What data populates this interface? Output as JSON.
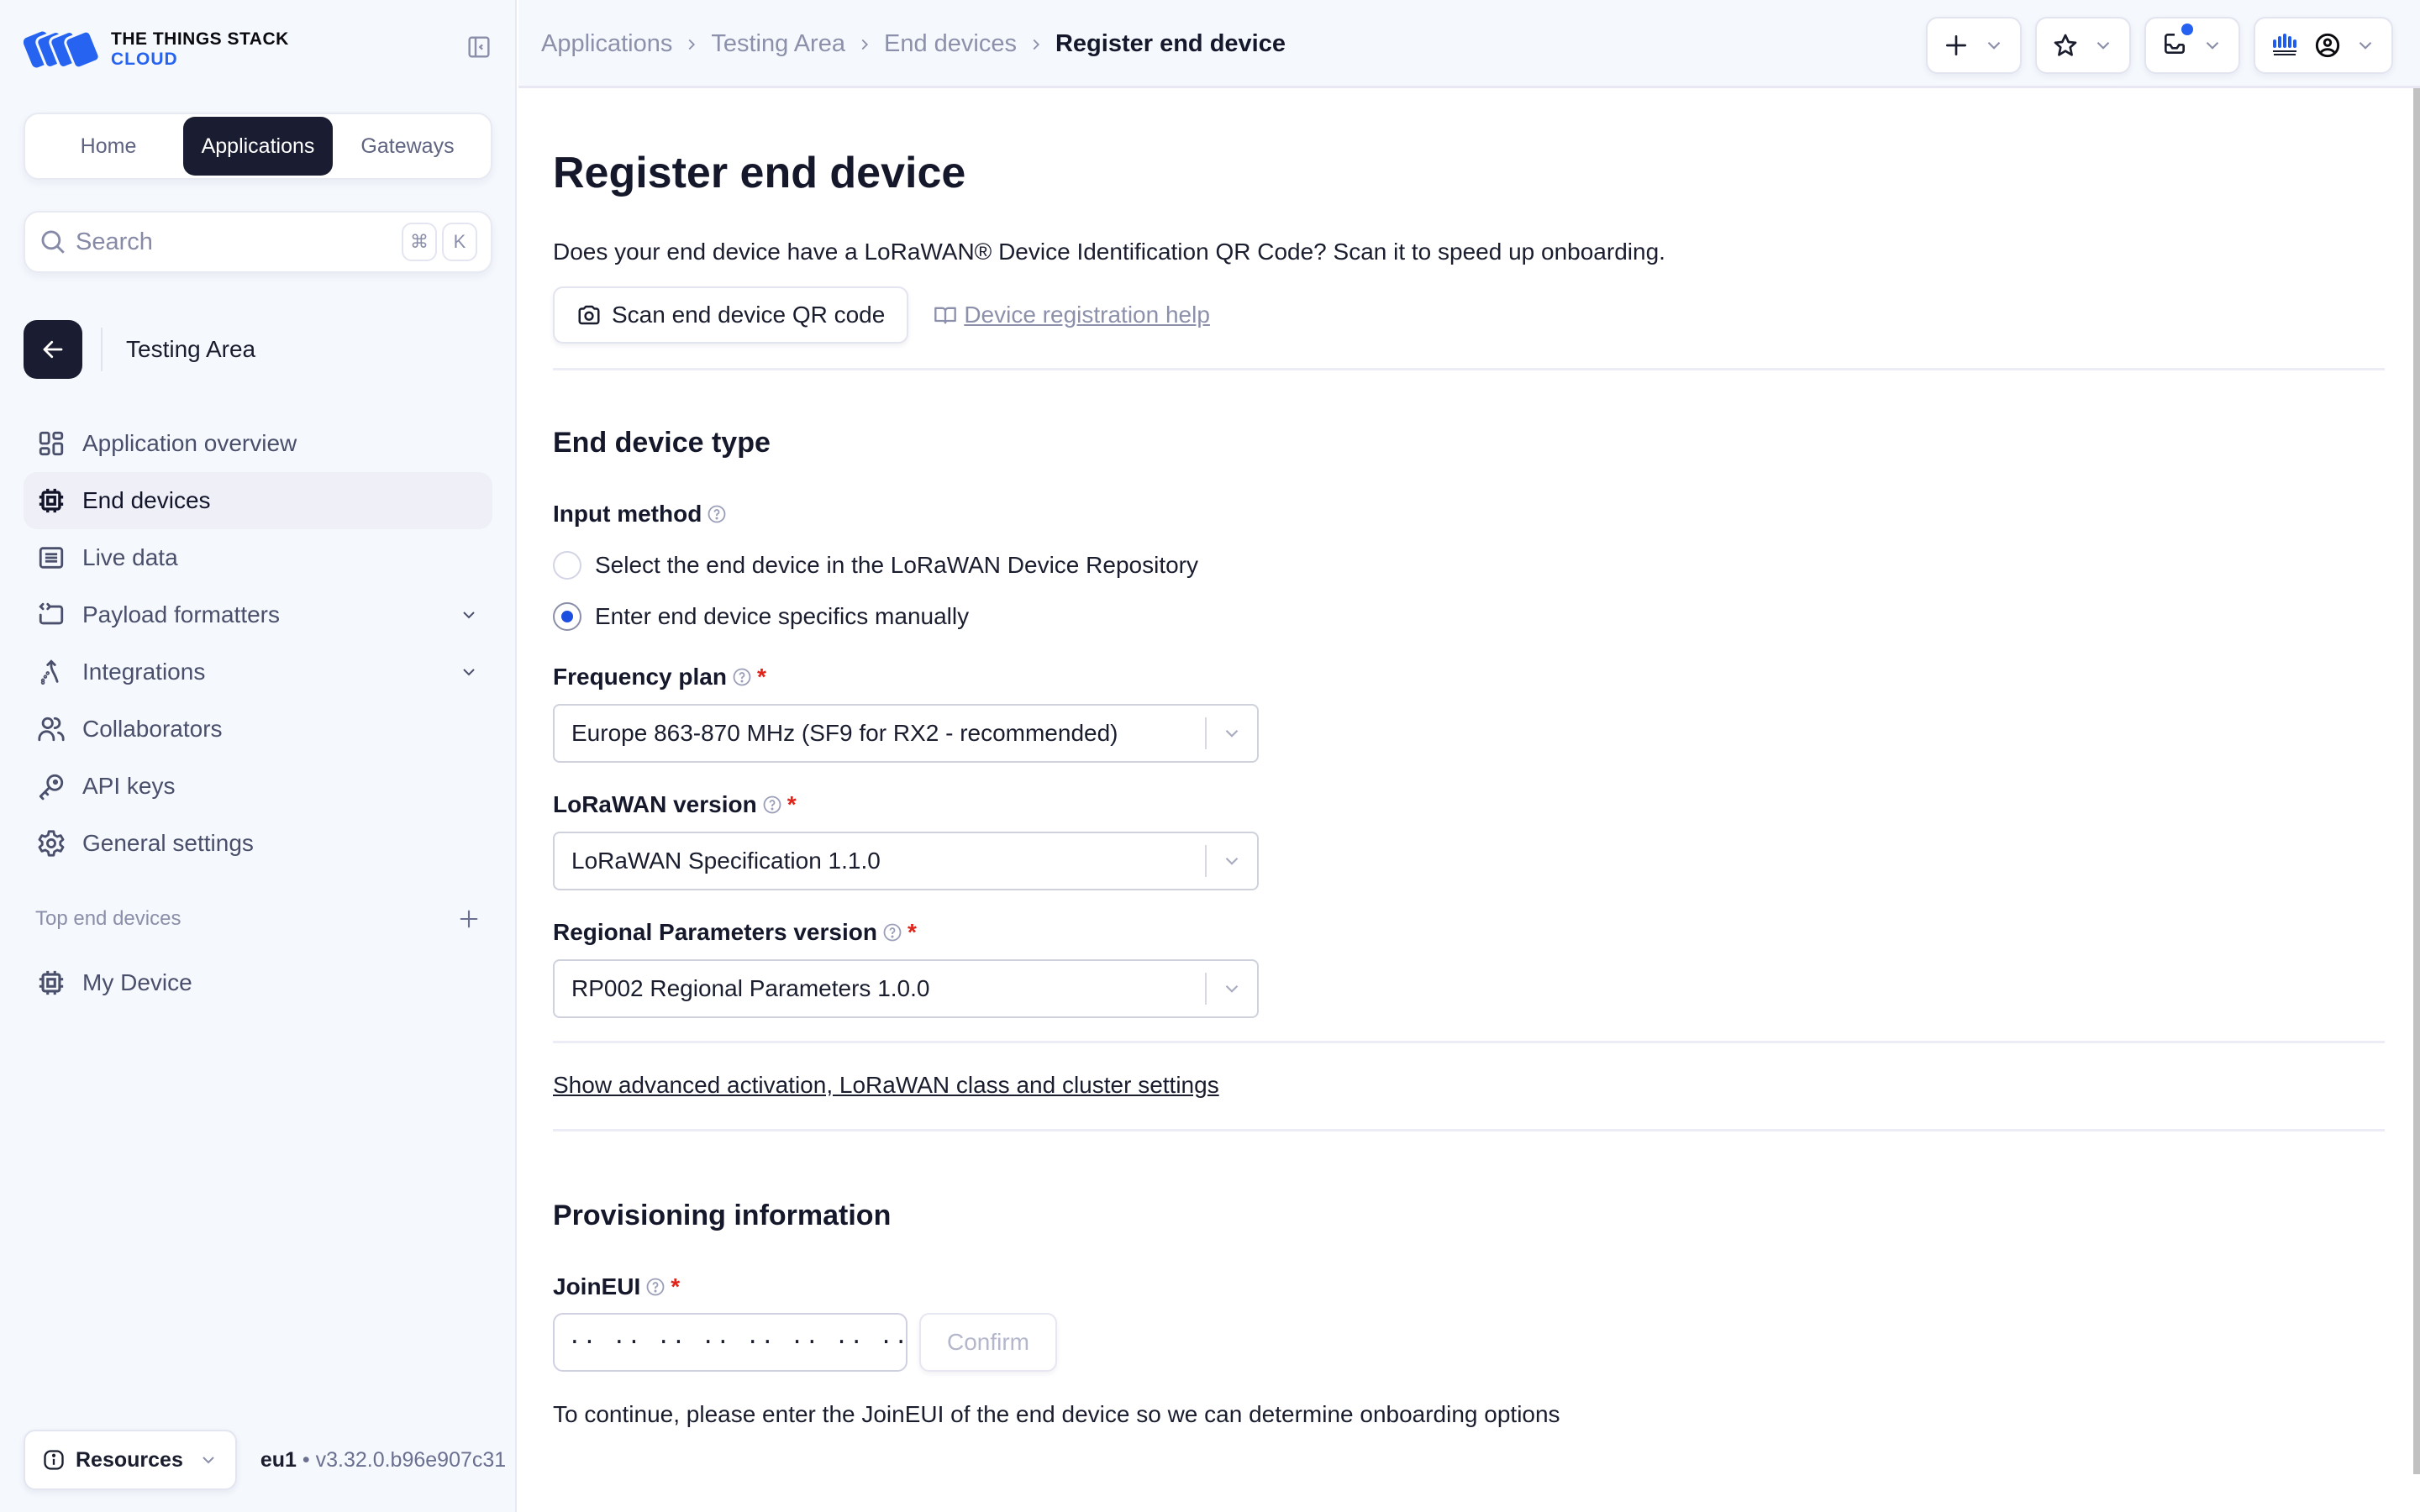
{
  "brand": {
    "line1": "THE THINGS STACK",
    "line2": "CLOUD",
    "color": "#2563f0"
  },
  "sidebar": {
    "switcher": [
      {
        "label": "Home",
        "active": false
      },
      {
        "label": "Applications",
        "active": true
      },
      {
        "label": "Gateways",
        "active": false
      }
    ],
    "search": {
      "placeholder": "Search",
      "shortcut": [
        "⌘",
        "K"
      ]
    },
    "context_title": "Testing Area",
    "items": [
      {
        "label": "Application overview",
        "icon": "dashboard-icon",
        "active": false
      },
      {
        "label": "End devices",
        "icon": "chip-icon",
        "active": true
      },
      {
        "label": "Live data",
        "icon": "list-icon",
        "active": false
      },
      {
        "label": "Payload formatters",
        "icon": "code-icon",
        "active": false,
        "expandable": true
      },
      {
        "label": "Integrations",
        "icon": "integrations-icon",
        "active": false,
        "expandable": true
      },
      {
        "label": "Collaborators",
        "icon": "users-icon",
        "active": false
      },
      {
        "label": "API keys",
        "icon": "key-icon",
        "active": false
      },
      {
        "label": "General settings",
        "icon": "gear-icon",
        "active": false
      }
    ],
    "top_devices_label": "Top end devices",
    "top_devices": [
      {
        "label": "My Device",
        "icon": "chip-icon"
      }
    ],
    "footer": {
      "resources_label": "Resources",
      "cluster": "eu1",
      "separator": " • ",
      "version": "v3.32.0.b96e907c31"
    }
  },
  "header": {
    "breadcrumbs": [
      "Applications",
      "Testing Area",
      "End devices",
      "Register end device"
    ],
    "notification_dot_color": "#2461f1"
  },
  "main": {
    "title": "Register end device",
    "intro": "Does your end device have a LoRaWAN® Device Identification QR Code? Scan it to speed up onboarding.",
    "scan_button": "Scan end device QR code",
    "help_link": "Device registration help",
    "section_type": {
      "title": "End device type",
      "input_method_label": "Input method",
      "input_methods": [
        {
          "label": "Select the end device in the LoRaWAN Device Repository",
          "checked": false
        },
        {
          "label": "Enter end device specifics manually",
          "checked": true
        }
      ],
      "frequency_plan": {
        "label": "Frequency plan",
        "required": "*",
        "value": "Europe 863-870 MHz (SF9 for RX2 - recommended)"
      },
      "lorawan_version": {
        "label": "LoRaWAN version",
        "required": "*",
        "value": "LoRaWAN Specification 1.1.0"
      },
      "regional_params": {
        "label": "Regional Parameters version",
        "required": "*",
        "value": "RP002 Regional Parameters 1.0.0"
      }
    },
    "advanced_link": "Show advanced activation, LoRaWAN class and cluster settings",
    "section_provisioning": {
      "title": "Provisioning information",
      "join_eui": {
        "label": "JoinEUI",
        "required": "*",
        "placeholder": "·· ·· ·· ·· ·· ·· ·· ··",
        "value": ""
      },
      "confirm_label": "Confirm",
      "hint": "To continue, please enter the JoinEUI of the end device so we can determine onboarding options"
    }
  }
}
